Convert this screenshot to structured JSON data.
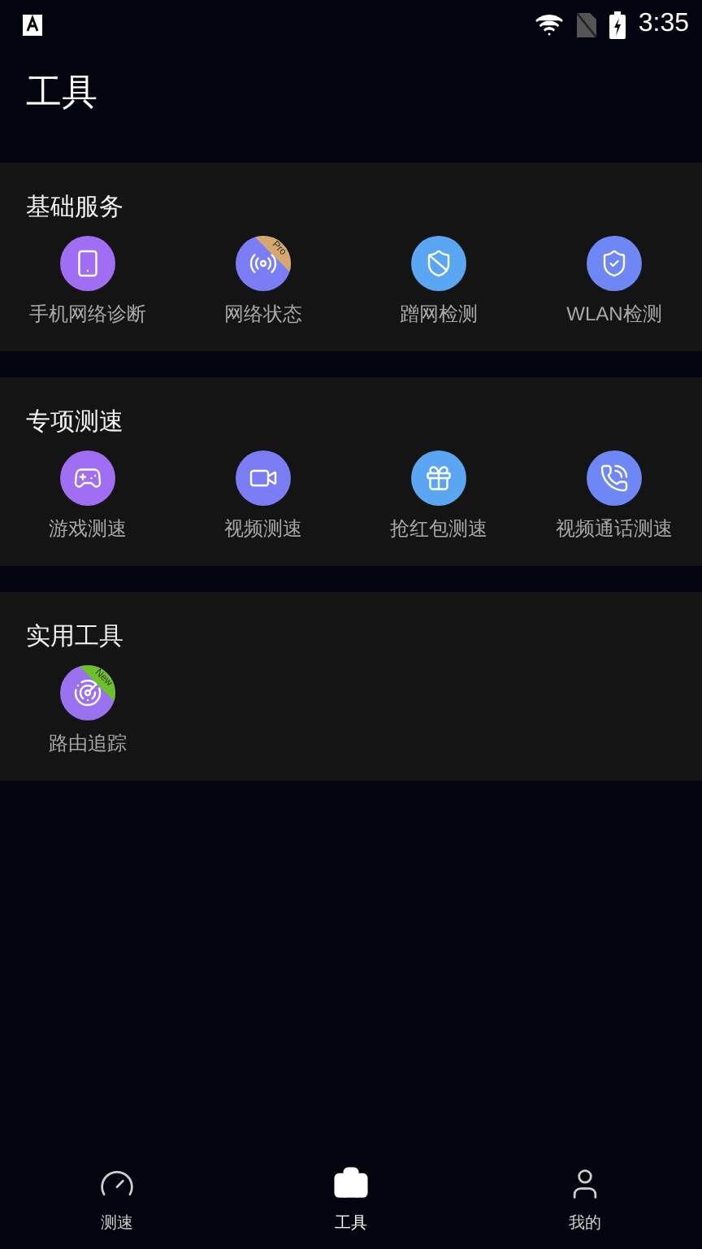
{
  "status_bar": {
    "time": "3:35"
  },
  "title": "工具",
  "sections": [
    {
      "title": "基础服务",
      "tools": [
        {
          "label": "手机网络诊断",
          "color": "#a06ef2"
        },
        {
          "label": "网络状态",
          "color": "#7b7df5",
          "badge": {
            "text": "Pro",
            "color": "#d7a86e"
          }
        },
        {
          "label": "蹭网检测",
          "color": "#5aa6f2"
        },
        {
          "label": "WLAN检测",
          "color": "#6f86f5"
        }
      ]
    },
    {
      "title": "专项测速",
      "tools": [
        {
          "label": "游戏测速",
          "color": "#a06ef2"
        },
        {
          "label": "视频测速",
          "color": "#7b7df5"
        },
        {
          "label": "抢红包测速",
          "color": "#5aa6f2"
        },
        {
          "label": "视频通话测速",
          "color": "#6f86f5"
        }
      ]
    },
    {
      "title": "实用工具",
      "tools": [
        {
          "label": "路由追踪",
          "color": "#9a72f0",
          "badge": {
            "text": "New",
            "color": "#6cc02c"
          }
        }
      ]
    }
  ],
  "tabs": [
    {
      "label": "测速",
      "selected": false
    },
    {
      "label": "工具",
      "selected": true
    },
    {
      "label": "我的",
      "selected": false
    }
  ]
}
